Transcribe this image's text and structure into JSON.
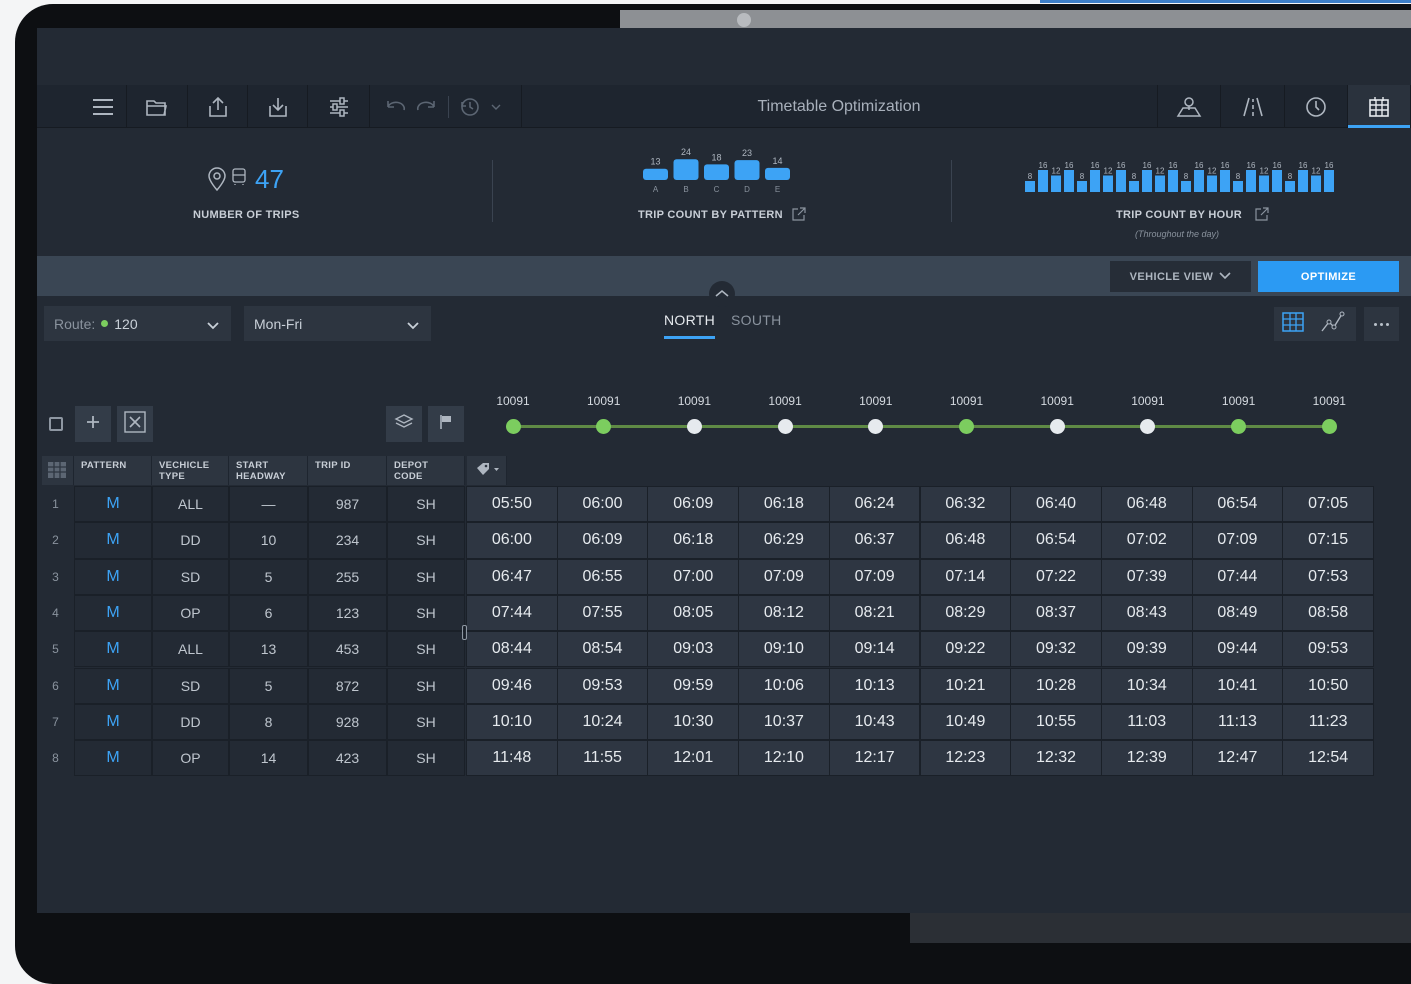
{
  "app": {
    "title": "Timetable Optimization"
  },
  "toolbar": {
    "buttons": [
      "menu-icon",
      "open-folder-icon",
      "upload-icon",
      "download-icon",
      "settings-sliders-icon",
      "undo-icon",
      "redo-icon",
      "history-icon"
    ],
    "right_tabs": [
      "map-icon",
      "road-icon",
      "clock-icon",
      "calendar-grid-icon"
    ],
    "active_tab": "calendar-grid-icon"
  },
  "stats": {
    "trips": {
      "value": "47",
      "label": "NUMBER OF TRIPS"
    },
    "by_pattern": {
      "label": "TRIP COUNT BY PATTERN",
      "categories": [
        "A",
        "B",
        "C",
        "D",
        "E"
      ],
      "values": [
        13,
        24,
        18,
        23,
        14
      ]
    },
    "by_hour": {
      "label": "TRIP COUNT BY HOUR",
      "sublabel": "(Throughout the day)",
      "values": [
        8,
        16,
        12,
        16,
        8,
        16,
        12,
        16,
        8,
        16,
        12,
        16,
        8,
        16,
        12,
        16,
        8,
        16,
        12,
        16,
        8,
        16,
        12,
        16
      ]
    }
  },
  "actions": {
    "vehicle_view": "VEHICLE VIEW",
    "optimize": "OPTIMIZE"
  },
  "filters": {
    "route_label": "Route:",
    "route_value": "120",
    "route_color": "#7ccd5f",
    "days": "Mon-Fri"
  },
  "directions": {
    "active": "NORTH",
    "inactive": "SOUTH"
  },
  "stops": {
    "ids": [
      "10091",
      "10091",
      "10091",
      "10091",
      "10091",
      "10091",
      "10091",
      "10091",
      "10091",
      "10091"
    ],
    "types": [
      "green",
      "green",
      "white",
      "white",
      "white",
      "green",
      "white",
      "white",
      "green",
      "green"
    ]
  },
  "table": {
    "headers": [
      "PATTERN",
      "VECHICLE\nTYPE",
      "START\nHEADWAY",
      "TRIP ID",
      "DEPOT\nCODE"
    ],
    "rows": [
      {
        "n": "1",
        "pattern": "M",
        "vtype": "ALL",
        "headway": "—",
        "trip": "987",
        "depot": "SH",
        "times": [
          "05:50",
          "06:00",
          "06:09",
          "06:18",
          "06:24",
          "06:32",
          "06:40",
          "06:48",
          "06:54",
          "07:05"
        ]
      },
      {
        "n": "2",
        "pattern": "M",
        "vtype": "DD",
        "headway": "10",
        "trip": "234",
        "depot": "SH",
        "times": [
          "06:00",
          "06:09",
          "06:18",
          "06:29",
          "06:37",
          "06:48",
          "06:54",
          "07:02",
          "07:09",
          "07:15"
        ]
      },
      {
        "n": "3",
        "pattern": "M",
        "vtype": "SD",
        "headway": "5",
        "trip": "255",
        "depot": "SH",
        "times": [
          "06:47",
          "06:55",
          "07:00",
          "07:09",
          "07:09",
          "07:14",
          "07:22",
          "07:39",
          "07:44",
          "07:53"
        ]
      },
      {
        "n": "4",
        "pattern": "M",
        "vtype": "OP",
        "headway": "6",
        "trip": "123",
        "depot": "SH",
        "times": [
          "07:44",
          "07:55",
          "08:05",
          "08:12",
          "08:21",
          "08:29",
          "08:37",
          "08:43",
          "08:49",
          "08:58"
        ]
      },
      {
        "n": "5",
        "pattern": "M",
        "vtype": "ALL",
        "headway": "13",
        "trip": "453",
        "depot": "SH",
        "times": [
          "08:44",
          "08:54",
          "09:03",
          "09:10",
          "09:14",
          "09:22",
          "09:32",
          "09:39",
          "09:44",
          "09:53"
        ]
      },
      {
        "n": "6",
        "pattern": "M",
        "vtype": "SD",
        "headway": "5",
        "trip": "872",
        "depot": "SH",
        "times": [
          "09:46",
          "09:53",
          "09:59",
          "10:06",
          "10:13",
          "10:21",
          "10:28",
          "10:34",
          "10:41",
          "10:50"
        ]
      },
      {
        "n": "7",
        "pattern": "M",
        "vtype": "DD",
        "headway": "8",
        "trip": "928",
        "depot": "SH",
        "times": [
          "10:10",
          "10:24",
          "10:30",
          "10:37",
          "10:43",
          "10:49",
          "10:55",
          "11:03",
          "11:13",
          "11:23"
        ]
      },
      {
        "n": "8",
        "pattern": "M",
        "vtype": "OP",
        "headway": "14",
        "trip": "423",
        "depot": "SH",
        "times": [
          "11:48",
          "11:55",
          "12:01",
          "12:10",
          "12:17",
          "12:23",
          "12:32",
          "12:39",
          "12:47",
          "12:54"
        ]
      }
    ]
  },
  "colors": {
    "accent": "#3da3f5",
    "stop_green": "#7ccd5f",
    "stop_white": "#e6eaee"
  }
}
